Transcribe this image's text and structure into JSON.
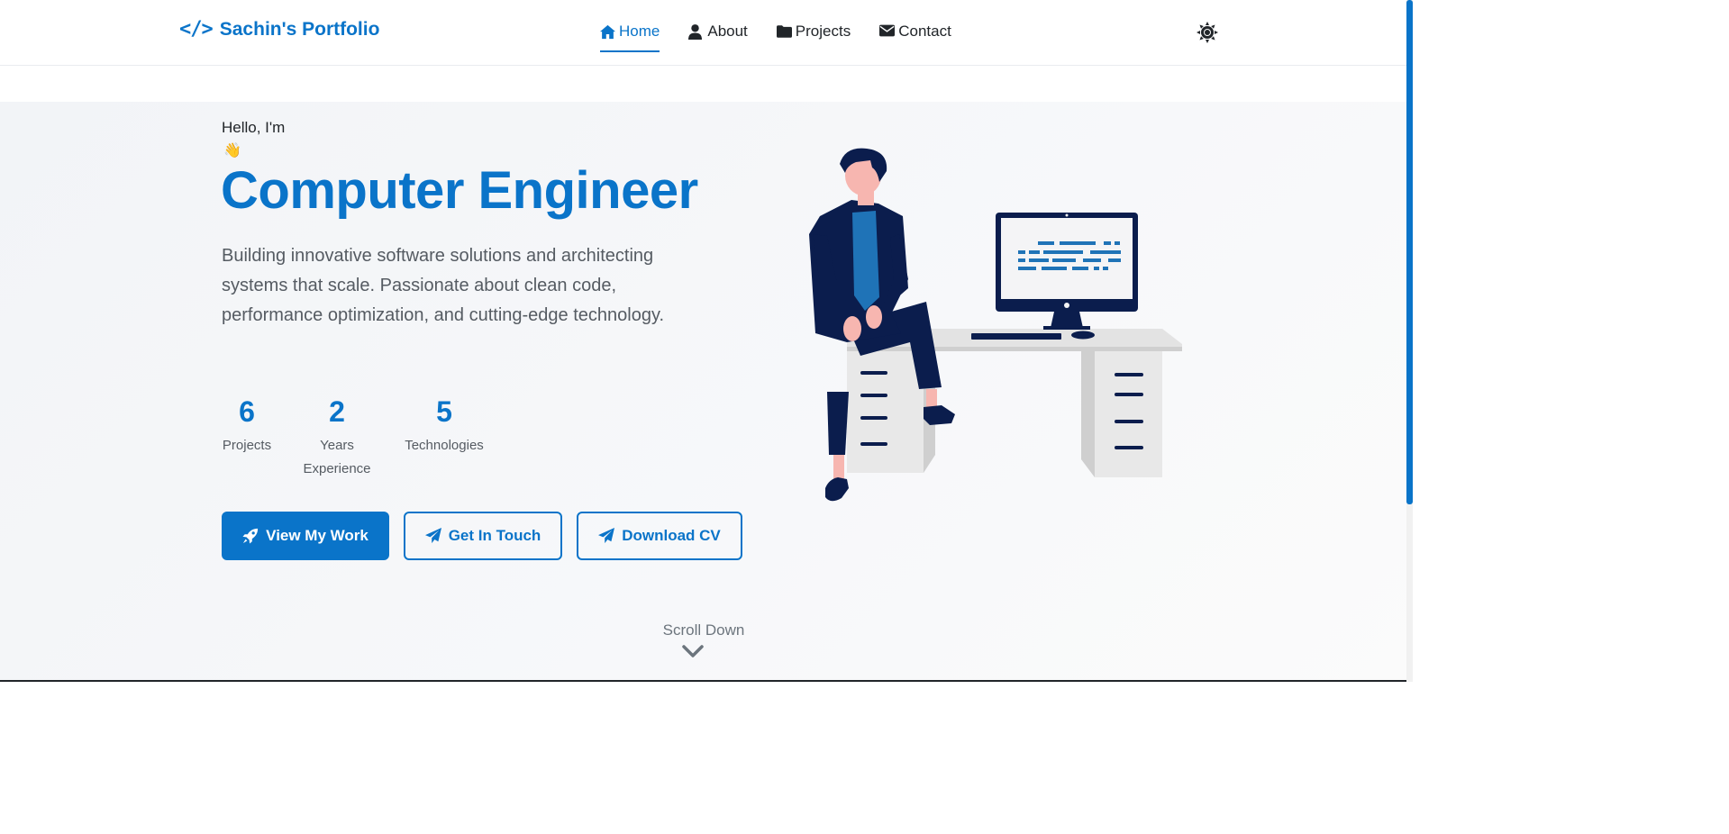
{
  "nav": {
    "brand": "Sachin's Portfolio",
    "items": [
      {
        "label": "Home",
        "icon": "home-icon",
        "active": true
      },
      {
        "label": "About",
        "icon": "user-icon",
        "active": false
      },
      {
        "label": "Projects",
        "icon": "folder-icon",
        "active": false
      },
      {
        "label": "Contact",
        "icon": "envelope-icon",
        "active": false
      }
    ],
    "theme_icon": "sun-icon"
  },
  "hero": {
    "greeting": "Hello, I'm",
    "wave": "👋",
    "headline": "Computer Engineer",
    "description": "Building innovative software solutions and architecting systems that scale. Passionate about clean code, performance optimization, and cutting-edge technology.",
    "stats": [
      {
        "number": "6",
        "label": "Projects"
      },
      {
        "number": "2",
        "label": "Years Experience"
      },
      {
        "number": "5",
        "label": "Technologies"
      }
    ],
    "buttons": {
      "view_work": "View My Work",
      "get_in_touch": "Get In Touch",
      "download_cv": "Download CV"
    },
    "scroll_label": "Scroll Down"
  },
  "colors": {
    "accent": "#0a74c9",
    "text": "#212529",
    "muted": "#555b62"
  }
}
